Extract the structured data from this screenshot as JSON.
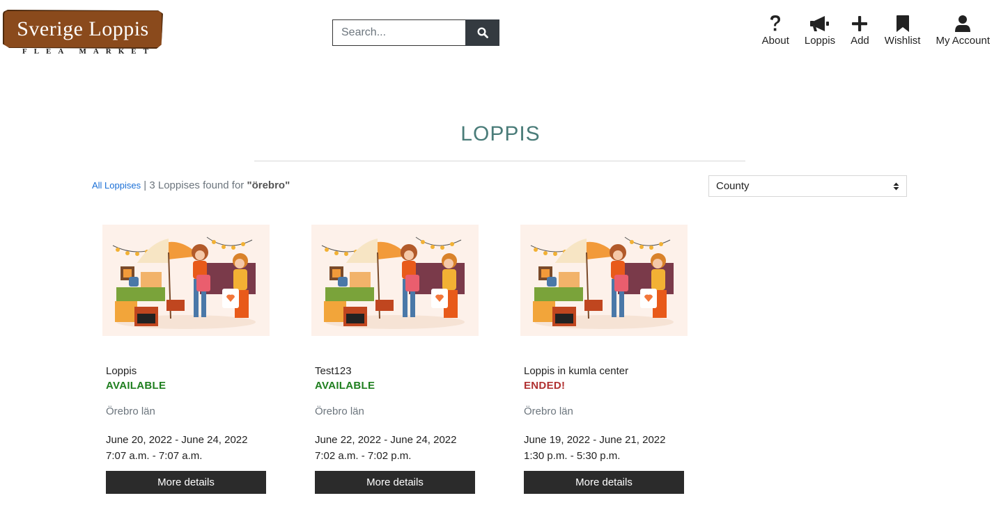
{
  "logo": {
    "title": "Sverige Loppis",
    "subtitle": "FLEA MARKET"
  },
  "search": {
    "placeholder": "Search...",
    "value": ""
  },
  "nav": [
    {
      "icon": "question-icon",
      "label": "About"
    },
    {
      "icon": "megaphone-icon",
      "label": "Loppis"
    },
    {
      "icon": "plus-icon",
      "label": "Add"
    },
    {
      "icon": "bookmark-icon",
      "label": "Wishlist"
    },
    {
      "icon": "user-icon",
      "label": "My Account"
    }
  ],
  "page": {
    "title": "LOPPIS",
    "all_link": "All Loppises",
    "separator": "|",
    "results_text": "3 Loppises found for",
    "query": "\"örebro\""
  },
  "filter": {
    "county_selected": "County"
  },
  "colors": {
    "title": "#4a7c79",
    "available": "#1e7e1e",
    "ended": "#b03030",
    "button": "#2b2b2b"
  },
  "cards": [
    {
      "name": "Loppis",
      "status": "AVAILABLE",
      "county": "Örebro län",
      "dates": "June 20, 2022 - June 24, 2022",
      "times": "7:07 a.m. - 7:07 a.m.",
      "button": "More details"
    },
    {
      "name": "Test123",
      "status": "AVAILABLE",
      "county": "Örebro län",
      "dates": "June 22, 2022 - June 24, 2022",
      "times": "7:02 a.m. - 7:02 p.m.",
      "button": "More details"
    },
    {
      "name": "Loppis in kumla center",
      "status": "ENDED!",
      "county": "Örebro län",
      "dates": "June 19, 2022 - June 21, 2022",
      "times": "1:30 p.m. - 5:30 p.m.",
      "button": "More details"
    }
  ]
}
